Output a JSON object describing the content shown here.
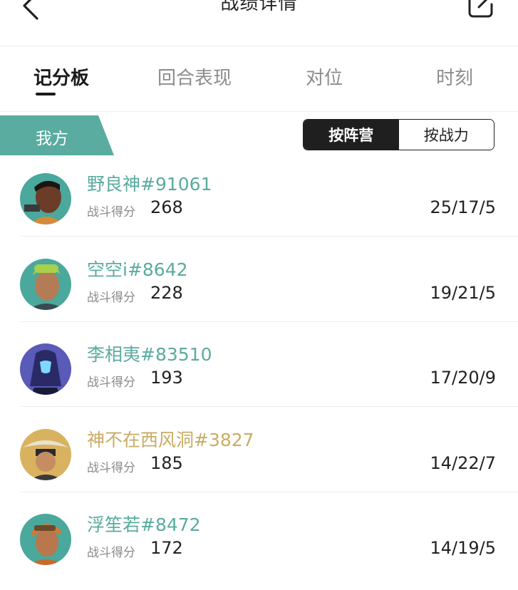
{
  "header": {
    "title": "战绩详情"
  },
  "tabs": [
    {
      "label": "记分板"
    },
    {
      "label": "回合表现"
    },
    {
      "label": "对位"
    },
    {
      "label": "时刻"
    }
  ],
  "team": {
    "label": "我方",
    "color": "#5aaba0"
  },
  "sort_toggle": {
    "by_camp": "按阵营",
    "by_power": "按战力",
    "selected": "按阵营"
  },
  "colors": {
    "name_teal": "#5aab9e",
    "name_gold": "#c9ac63"
  },
  "players": [
    {
      "name": "野良神#91061",
      "score_label": "战斗得分",
      "score": "268",
      "kda": "25/17/5",
      "name_color": "#5aab9e"
    },
    {
      "name": "空空i#8642",
      "score_label": "战斗得分",
      "score": "228",
      "kda": "19/21/5",
      "name_color": "#5aab9e"
    },
    {
      "name": "李相夷#83510",
      "score_label": "战斗得分",
      "score": "193",
      "kda": "17/20/9",
      "name_color": "#5aab9e"
    },
    {
      "name": "神不在西风洞#3827",
      "score_label": "战斗得分",
      "score": "185",
      "kda": "14/22/7",
      "name_color": "#c9ac63"
    },
    {
      "name": "浮笙若#8472",
      "score_label": "战斗得分",
      "score": "172",
      "kda": "14/19/5",
      "name_color": "#5aab9e"
    }
  ]
}
